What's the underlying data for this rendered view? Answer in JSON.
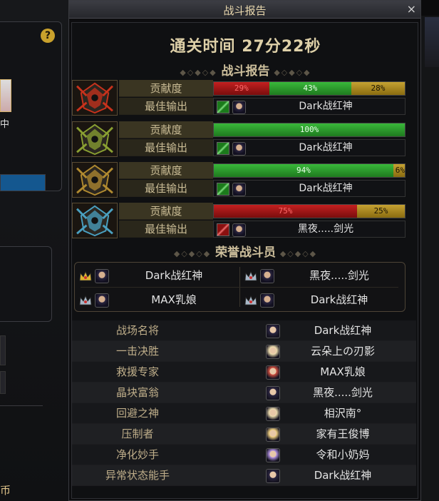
{
  "left": {
    "help_icon": "?",
    "bottom_text": "币",
    "side_text": "中"
  },
  "window": {
    "title": "战斗报告",
    "close": "×"
  },
  "clear_time": "通关时间  27分22秒",
  "section_report": "战斗报告",
  "section_honor": "荣誉战斗员",
  "labels": {
    "contribution": "贡献度",
    "best_output": "最佳输出"
  },
  "bosses": [
    {
      "icon": "fire-boss-icon",
      "color": "#c8321c",
      "segments": [
        {
          "pct": 29,
          "label": "29%",
          "color": "red"
        },
        {
          "pct": 43,
          "label": "43%",
          "color": "green"
        },
        {
          "pct": 28,
          "label": "28%",
          "color": "gold"
        }
      ],
      "best_job": "g",
      "best_name": "Dark战红神"
    },
    {
      "icon": "nature-boss-icon",
      "color": "#8aa032",
      "segments": [
        {
          "pct": 100,
          "label": "100%",
          "color": "green"
        }
      ],
      "best_job": "g",
      "best_name": "Dark战红神"
    },
    {
      "icon": "earth-boss-icon",
      "color": "#b08a30",
      "segments": [
        {
          "pct": 94,
          "label": "94%",
          "color": "green"
        },
        {
          "pct": 6,
          "label": "6%",
          "color": "gold"
        }
      ],
      "best_job": "g",
      "best_name": "Dark战红神"
    },
    {
      "icon": "ice-boss-icon",
      "color": "#4aa0c0",
      "segments": [
        {
          "pct": 75,
          "label": "75%",
          "color": "red"
        },
        {
          "pct": 25,
          "label": "25%",
          "color": "gold"
        }
      ],
      "best_job": "r",
      "best_name": "黑夜.....剑光"
    }
  ],
  "honor": [
    {
      "crown": "gold",
      "name": "Dark战红神"
    },
    {
      "crown": "silver",
      "name": "黑夜.....剑光"
    },
    {
      "crown": "silver",
      "name": "MAX乳娘"
    },
    {
      "crown": "silver",
      "name": "Dark战红神"
    }
  ],
  "awards": [
    {
      "title": "战场名将",
      "player": "Dark战红神"
    },
    {
      "title": "一击决胜",
      "player": "云朵上の刃影"
    },
    {
      "title": "救援专家",
      "player": "MAX乳娘"
    },
    {
      "title": "晶块富翁",
      "player": "黑夜.....剑光"
    },
    {
      "title": "回避之神",
      "player": "相沢南°"
    },
    {
      "title": "压制者",
      "player": "家有王俊博"
    },
    {
      "title": "净化妙手",
      "player": "令和小奶妈"
    },
    {
      "title": "异常状态能手",
      "player": "Dark战红神"
    }
  ]
}
